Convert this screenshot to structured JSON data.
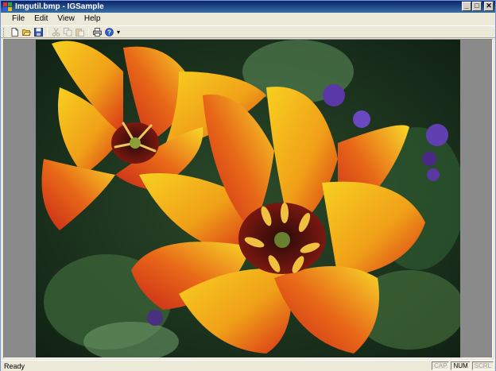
{
  "window": {
    "title": "Imgutil.bmp - IGSample",
    "controls": {
      "minimize": "_",
      "maximize": "□",
      "close": "✕"
    }
  },
  "menu": {
    "items": [
      "File",
      "Edit",
      "View",
      "Help"
    ]
  },
  "toolbar": {
    "buttons": [
      {
        "icon": "new-file-icon",
        "enabled": true
      },
      {
        "icon": "open-folder-icon",
        "enabled": true
      },
      {
        "icon": "save-icon",
        "enabled": true
      },
      {
        "icon": "cut-icon",
        "enabled": false
      },
      {
        "icon": "copy-icon",
        "enabled": false
      },
      {
        "icon": "paste-icon",
        "enabled": false
      },
      {
        "icon": "print-icon",
        "enabled": true
      },
      {
        "icon": "help-icon",
        "enabled": true
      }
    ],
    "overflow": "▾"
  },
  "image": {
    "subject": "red-and-yellow tulips",
    "colors": {
      "background": "#1f3a22",
      "petal_yellow": "#f5c51a",
      "petal_red": "#d8321a",
      "center": "#3a0d0a"
    }
  },
  "status": {
    "text": "Ready",
    "indicators": [
      {
        "label": "CAP",
        "active": false
      },
      {
        "label": "NUM",
        "active": true
      },
      {
        "label": "SCRL",
        "active": false
      }
    ]
  }
}
